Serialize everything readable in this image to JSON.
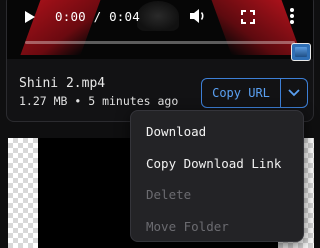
{
  "player": {
    "time": "0:00 / 0:04",
    "icons": [
      "play-icon",
      "volume-icon",
      "fullscreen-icon",
      "more-vert-icon"
    ]
  },
  "file": {
    "name": "Shini 2.mp4",
    "info": "1.27 MB • 5 minutes ago"
  },
  "actions": {
    "copy_url": "Copy URL"
  },
  "menu": {
    "items": [
      {
        "label": "Download",
        "disabled": false
      },
      {
        "label": "Copy Download Link",
        "disabled": false
      },
      {
        "label": "Delete",
        "disabled": true
      },
      {
        "label": "Move Folder",
        "disabled": true
      }
    ]
  },
  "colors": {
    "accent": "#3d7fd6",
    "accent_text": "#5aa0f2",
    "menu_bg": "#232326",
    "disabled_text": "#6b6b70"
  }
}
